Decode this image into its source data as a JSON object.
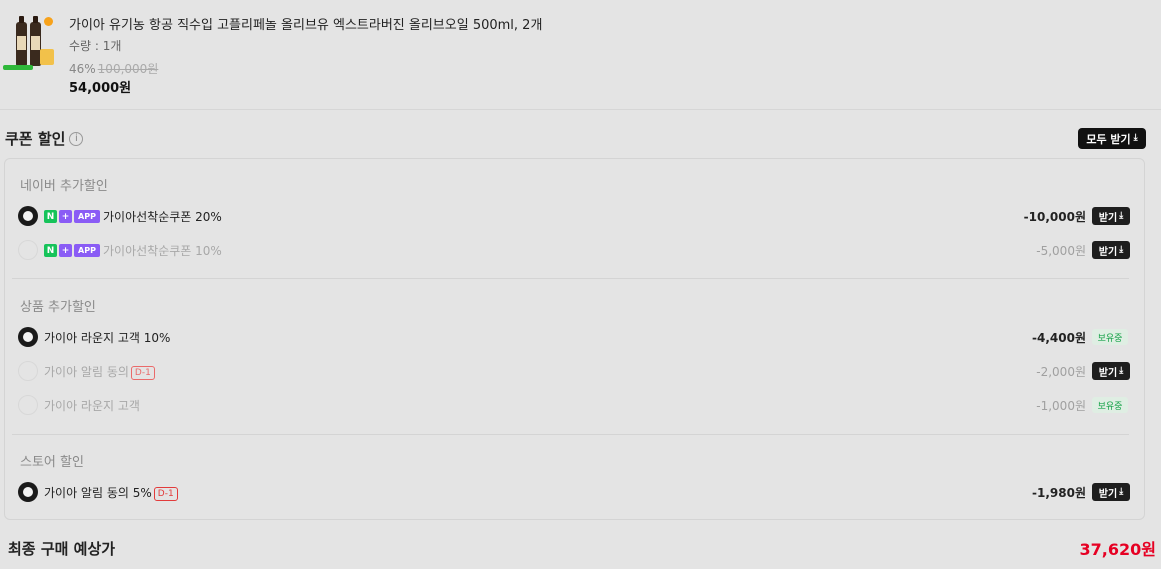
{
  "product": {
    "title": "가이아 유기농 항공 직수입 고플리페놀 올리브유 엑스트라버진 올리브오일 500ml, 2개",
    "quantity": "수량 : 1개",
    "discount_rate": "46%",
    "original_price": "100,000원",
    "price": "54,000원"
  },
  "coupons": {
    "header": "쿠폰 할인",
    "info_icon": "i",
    "download_all": "모두 받기",
    "groups": [
      {
        "title": "네이버 추가할인",
        "items": [
          {
            "label": "가이아선착순쿠폰 20%",
            "badges": [
              "N",
              "+",
              "APP"
            ],
            "amount": "-10,000원",
            "action": "받기",
            "selected": true
          },
          {
            "label": "가이아선착순쿠폰 10%",
            "badges": [
              "N",
              "+",
              "APP"
            ],
            "amount": "-5,000원",
            "action": "받기",
            "selected": false
          }
        ]
      },
      {
        "title": "상품 추가할인",
        "items": [
          {
            "label": "가이아 라운지 고객 10%",
            "amount": "-4,400원",
            "action": "보유중",
            "selected": true
          },
          {
            "label": "가이아 알림 동의",
            "dday": "D-1",
            "amount": "-2,000원",
            "action": "받기",
            "selected": false
          },
          {
            "label": "가이아 라운지 고객",
            "amount": "-1,000원",
            "action": "보유중",
            "selected": false
          }
        ]
      },
      {
        "title": "스토어 할인",
        "items": [
          {
            "label": "가이아 알림 동의 5%",
            "dday": "D-1",
            "amount": "-1,980원",
            "action": "받기",
            "selected": true
          }
        ]
      }
    ]
  },
  "final": {
    "label": "최종 구매 예상가",
    "price": "37,620원"
  },
  "colors": {
    "background": "#e4e4e4",
    "final_price": "#e60023",
    "owned_tag": "#19a34a",
    "naver_green": "#16c35a",
    "app_purple": "#8a5cf5",
    "dday_red": "#e23b3b"
  }
}
